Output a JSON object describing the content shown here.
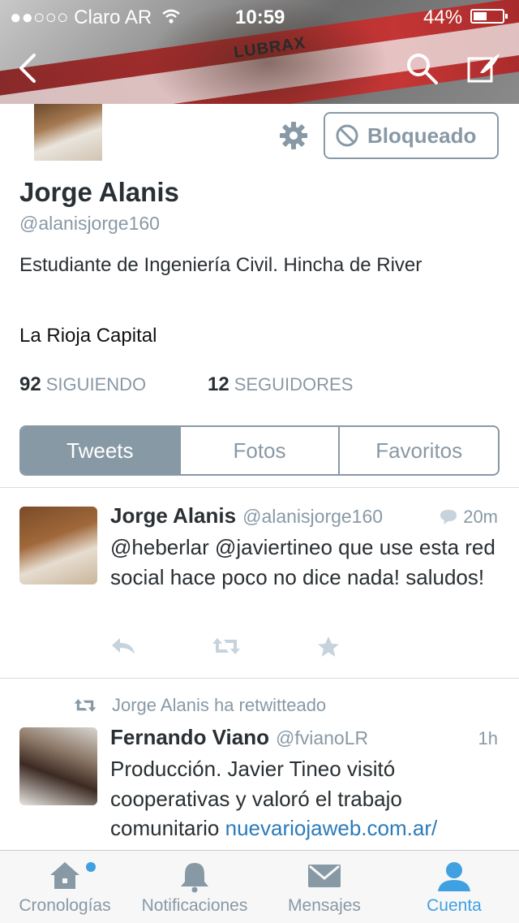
{
  "status_bar": {
    "carrier": "●●○○○ Claro AR",
    "time": "10:59",
    "battery": "44%"
  },
  "header": {
    "shirt_text": "LUBRAX"
  },
  "profile": {
    "name": "Jorge Alanis",
    "handle": "@alanisjorge160",
    "bio": "Estudiante de Ingeniería Civil. Hincha de River",
    "location": "La Rioja Capital",
    "blocked_label": "Bloqueado",
    "following_count": "92",
    "following_label": "SIGUIENDO",
    "followers_count": "12",
    "followers_label": "SEGUIDORES"
  },
  "tabs": [
    "Tweets",
    "Fotos",
    "Favoritos"
  ],
  "active_tab": "Tweets",
  "tweets": [
    {
      "author": "Jorge Alanis",
      "handle": "@alanisjorge160",
      "time": "20m",
      "text": "@heberlar @javiertineo que use esta red social hace poco no dice nada! saludos!"
    },
    {
      "retweet_note": "Jorge Alanis ha retwitteado",
      "author": "Fernando Viano",
      "handle": "@fvianoLR",
      "time": "1h",
      "text": "Producción. Javier Tineo visitó cooperativas y valoró el trabajo comunitario ",
      "link": "nuevariojaweb.com.ar/"
    }
  ],
  "tab_bar": {
    "items": [
      "Cronologías",
      "Notificaciones",
      "Mensajes",
      "Cuenta"
    ],
    "active": "Cuenta"
  },
  "colors": {
    "accent": "#3fa0e2",
    "muted": "#8899a6",
    "text": "#292f33",
    "link": "#2b7bb9"
  }
}
